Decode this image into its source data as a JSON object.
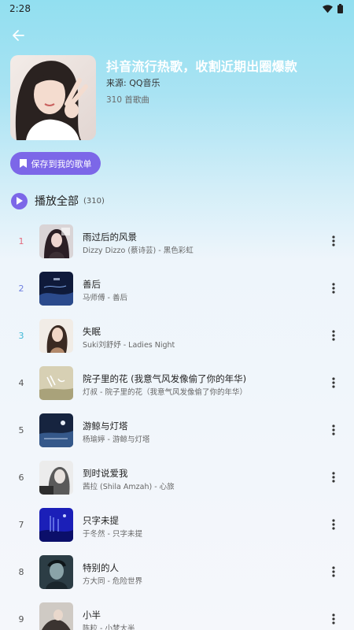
{
  "status_bar": {
    "time": "2:28"
  },
  "playlist": {
    "title": "抖音流行热歌，收割近期出圈爆款",
    "source": "来源: QQ音乐",
    "count_text": "310 首歌曲",
    "save_label": "保存到我的歌单"
  },
  "play_all": {
    "label": "播放全部",
    "count": "(310)"
  },
  "accent_color": "#7c67e8",
  "songs": [
    {
      "index": "1",
      "index_color": "#e36a7e",
      "title": "雨过后的风景",
      "subtitle": "Dizzy Dizzo (蔡诗芸) - 黑色彩虹"
    },
    {
      "index": "2",
      "index_color": "#6f7fe0",
      "title": "善后",
      "subtitle": "马师傅 - 善后"
    },
    {
      "index": "3",
      "index_color": "#3fb8d6",
      "title": "失眠",
      "subtitle": "Suki刘舒妤 - Ladies Night"
    },
    {
      "index": "4",
      "index_color": "#555555",
      "title": "院子里的花 (我意气风发像偷了你的年华)",
      "subtitle": "灯叔 - 院子里的花（我意气风发像偷了你的年华）"
    },
    {
      "index": "5",
      "index_color": "#555555",
      "title": "游鲸与灯塔",
      "subtitle": "杨瑜婷 - 游鲸与灯塔"
    },
    {
      "index": "6",
      "index_color": "#555555",
      "title": "到时说爱我",
      "subtitle": "茜拉 (Shila Amzah) - 心旅"
    },
    {
      "index": "7",
      "index_color": "#555555",
      "title": "只字未提",
      "subtitle": "于冬然 - 只字未提"
    },
    {
      "index": "8",
      "index_color": "#555555",
      "title": "特别的人",
      "subtitle": "方大同 - 危险世界"
    },
    {
      "index": "9",
      "index_color": "#555555",
      "title": "小半",
      "subtitle": "陈粒 - 小梦大半"
    }
  ]
}
